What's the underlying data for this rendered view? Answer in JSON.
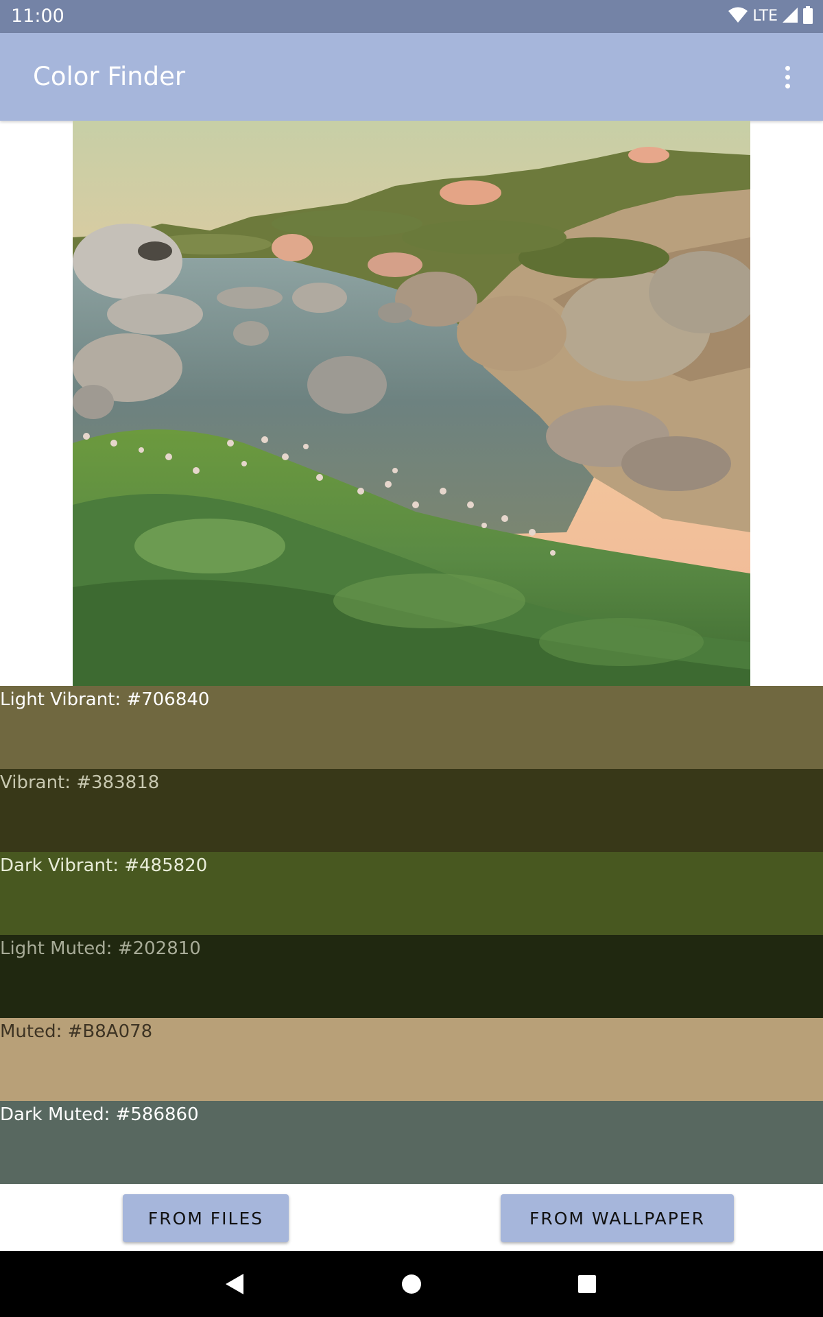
{
  "status_bar": {
    "time": "11:00",
    "network": "LTE",
    "icons": [
      "wifi-icon",
      "signal-icon",
      "battery-icon"
    ]
  },
  "app_bar": {
    "title": "Color Finder",
    "overflow_icon": "more-vert-icon"
  },
  "image": {
    "description_icon": "landscape-photo"
  },
  "swatches": [
    {
      "label": "Light Vibrant: #706840",
      "color": "#706840",
      "text_color": "#ffffff"
    },
    {
      "label": "Vibrant: #383818",
      "color": "#383818",
      "text_color": "#c8c8b0"
    },
    {
      "label": "Dark Vibrant: #485820",
      "color": "#485820",
      "text_color": "#e8ecd8"
    },
    {
      "label": "Light Muted: #202810",
      "color": "#202810",
      "text_color": "#a8ac98"
    },
    {
      "label": "Muted: #B8A078",
      "color": "#B8A078",
      "text_color": "#3e3424"
    },
    {
      "label": "Dark Muted: #586860",
      "color": "#586860",
      "text_color": "#ffffff"
    }
  ],
  "buttons": {
    "from_files": "FROM FILES",
    "from_wallpaper": "FROM WALLPAPER"
  },
  "nav_bar": {
    "icons": [
      "back-icon",
      "home-icon",
      "recents-icon"
    ]
  },
  "colors": {
    "status_bar": "#7483a6",
    "app_bar": "#a6b6db",
    "button": "#a6b6db"
  }
}
